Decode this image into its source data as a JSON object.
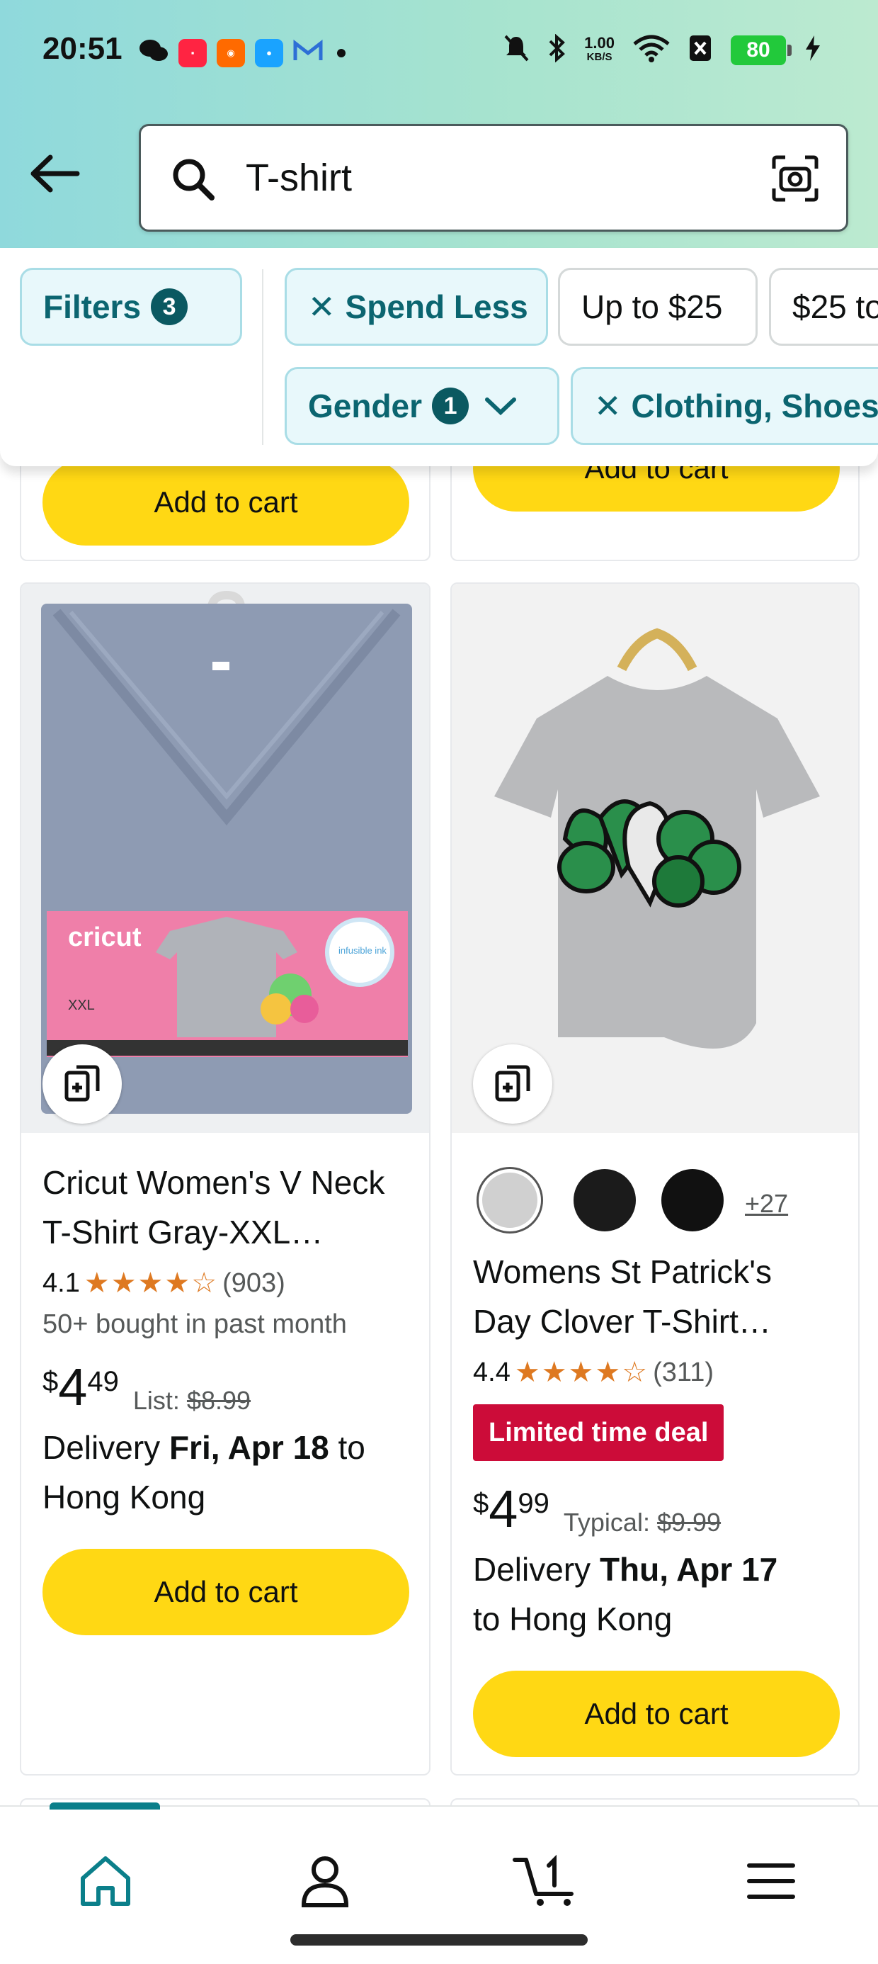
{
  "status_bar": {
    "time": "20:51",
    "net_speed": "1.00",
    "net_unit": "KB/S",
    "battery": "80"
  },
  "search": {
    "query": "T-shirt"
  },
  "filters": {
    "filters_label": "Filters",
    "filters_count": "3",
    "spend_less": "Spend Less",
    "up_to_25": "Up to $25",
    "over_25": "$25 to",
    "gender": "Gender",
    "gender_count": "1",
    "clothing": "Clothing, Shoes"
  },
  "top_row": {
    "left_cart_label": "Add to cart",
    "right_cart_label": "Add to cart"
  },
  "products": [
    {
      "title_line1": "Cricut Women's V Neck",
      "title_line2": "T-Shirt Gray-XXL…",
      "rating": "4.1",
      "reviews": "(903)",
      "bought": "50+ bought in past month",
      "price_symbol": "$",
      "price_whole": "4",
      "price_frac": "49",
      "strike_label": "List:",
      "strike_price": "$8.99",
      "delivery_pre": "Delivery ",
      "delivery_date": "Fri, Apr 18",
      "delivery_post": " to",
      "delivery_line2": "Hong Kong",
      "cart_label": "Add to cart",
      "image_brand": "cricut",
      "image_size": "XXL",
      "image_ink": "infusible ink"
    },
    {
      "more_colors": "+27",
      "title_line1": "Womens St Patrick's",
      "title_line2": "Day Clover T-Shirt…",
      "rating": "4.4",
      "reviews": "(311)",
      "deal": "Limited time deal",
      "price_symbol": "$",
      "price_whole": "4",
      "price_frac": "99",
      "strike_label": "Typical:",
      "strike_price": "$9.99",
      "delivery_pre": "Delivery ",
      "delivery_date": "Thu, Apr 17",
      "delivery_line2": "to Hong Kong",
      "cart_label": "Add to cart"
    }
  ],
  "colors": {
    "accent": "#0b6570",
    "cart_yellow": "#ffd814",
    "deal_red": "#cc0c39",
    "star_orange": "#de7921"
  },
  "icons": [
    "back-arrow-icon",
    "search-icon",
    "camera-lens-icon",
    "compare-icon",
    "home-icon",
    "account-icon",
    "cart-icon",
    "menu-icon"
  ]
}
